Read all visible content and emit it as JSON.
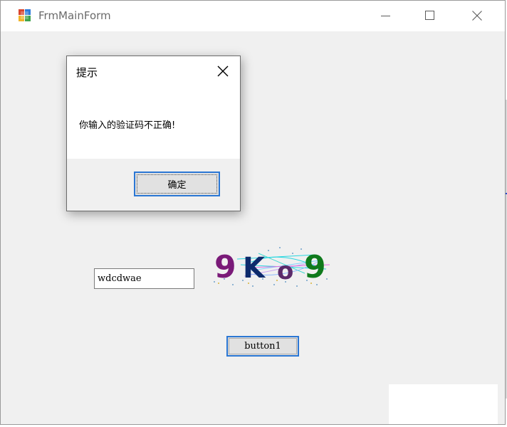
{
  "window": {
    "title": "FrmMainForm",
    "icon": "winforms-app-icon"
  },
  "caption_buttons": {
    "minimize_icon": "minimize-icon",
    "maximize_icon": "maximize-icon",
    "close_icon": "close-icon"
  },
  "form": {
    "input_value": "wdcdwae",
    "captcha_text": "9Ko9",
    "captcha_colors": [
      "#7a1a78",
      "#0d2a6b",
      "#5b2a6a",
      "#0f7a1c"
    ],
    "button_label": "button1"
  },
  "message_box": {
    "title": "提示",
    "message": "你输入的验证码不正确!",
    "ok_label": "确定"
  },
  "colors": {
    "focus_border": "#2b77d4",
    "client_bg": "#f0f0f0"
  }
}
